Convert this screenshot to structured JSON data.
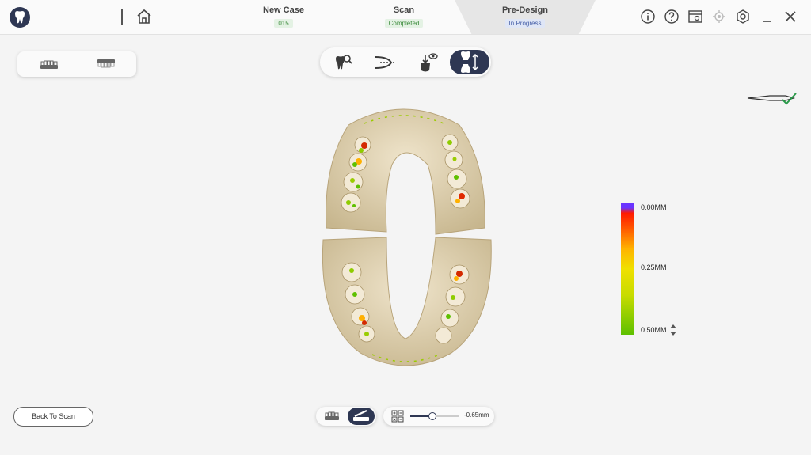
{
  "header": {
    "steps": [
      {
        "title": "New Case",
        "badge": "015",
        "badge_color": "#e4f2e4",
        "badge_text_color": "#3a8a3a"
      },
      {
        "title": "Scan",
        "badge": "Completed",
        "badge_color": "#e4f2e4",
        "badge_text_color": "#3a8a3a"
      },
      {
        "title": "Pre-Design",
        "badge": "In Progress",
        "badge_color": "#dfe6f6",
        "badge_text_color": "#4760a8"
      }
    ],
    "icons": [
      "info-icon",
      "help-icon",
      "screenshot-icon",
      "target-icon",
      "settings-icon",
      "minimize-icon",
      "close-icon"
    ]
  },
  "toolbar": {
    "tools": [
      "tooth-search-icon",
      "cut-curve-icon",
      "tooth-view-icon",
      "tooth-align-icon"
    ],
    "active_tool": "tooth-align-icon"
  },
  "jaw_toggle": [
    "upper-jaw-icon",
    "lower-jaw-icon"
  ],
  "legend": {
    "labels": [
      "0.00MM",
      "0.25MM",
      "0.50MM"
    ],
    "accent": "#2e3753"
  },
  "bottom": {
    "back_button": "Back To Scan",
    "slider_value": "-0.65mm",
    "slider_level": 0.45
  }
}
